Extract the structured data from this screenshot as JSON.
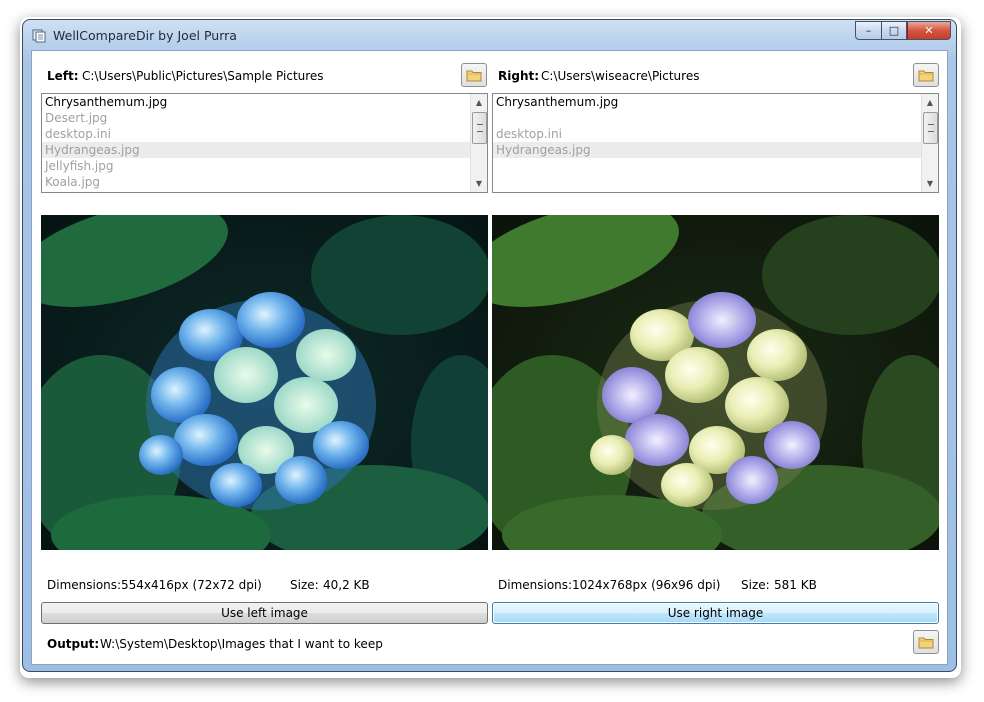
{
  "window": {
    "title": "WellCompareDir by Joel Purra",
    "controls": {
      "minimize": "–",
      "maximize": "□",
      "close": "✕"
    }
  },
  "left": {
    "label": "Left:",
    "path": "C:\\Users\\Public\\Pictures\\Sample Pictures",
    "files": [
      {
        "name": "Chrysanthemum.jpg",
        "state": "normal"
      },
      {
        "name": "Desert.jpg",
        "state": "dim"
      },
      {
        "name": "desktop.ini",
        "state": "dim"
      },
      {
        "name": "Hydrangeas.jpg",
        "state": "selected"
      },
      {
        "name": "Jellyfish.jpg",
        "state": "dim"
      },
      {
        "name": "Koala.jpg",
        "state": "dim"
      }
    ],
    "dimensions_label": "Dimensions:",
    "dimensions_value": "554x416px (72x72 dpi)",
    "size_label": "Size:",
    "size_value": "40,2 KB",
    "use_button": "Use left image"
  },
  "right": {
    "label": "Right:",
    "path": "C:\\Users\\wiseacre\\Pictures",
    "files": [
      {
        "name": "Chrysanthemum.jpg",
        "state": "normal"
      },
      {
        "name": "",
        "state": "empty"
      },
      {
        "name": "desktop.ini",
        "state": "dim"
      },
      {
        "name": "Hydrangeas.jpg",
        "state": "selected"
      }
    ],
    "dimensions_label": "Dimensions:",
    "dimensions_value": "1024x768px (96x96 dpi)",
    "size_label": "Size:",
    "size_value": "581 KB",
    "use_button": "Use right image"
  },
  "output": {
    "label": "Output:",
    "path": "W:\\System\\Desktop\\Images that I want to keep"
  },
  "icons": {
    "app": "app-icon",
    "browse": "folder-icon",
    "scroll_up": "scroll-up-icon",
    "scroll_down": "scroll-down-icon"
  },
  "colors": {
    "frame": "#a9c6e8",
    "close_button": "#c63e28",
    "focused_button": "#3c7fb1",
    "dim_text": "#a0a0a0"
  }
}
